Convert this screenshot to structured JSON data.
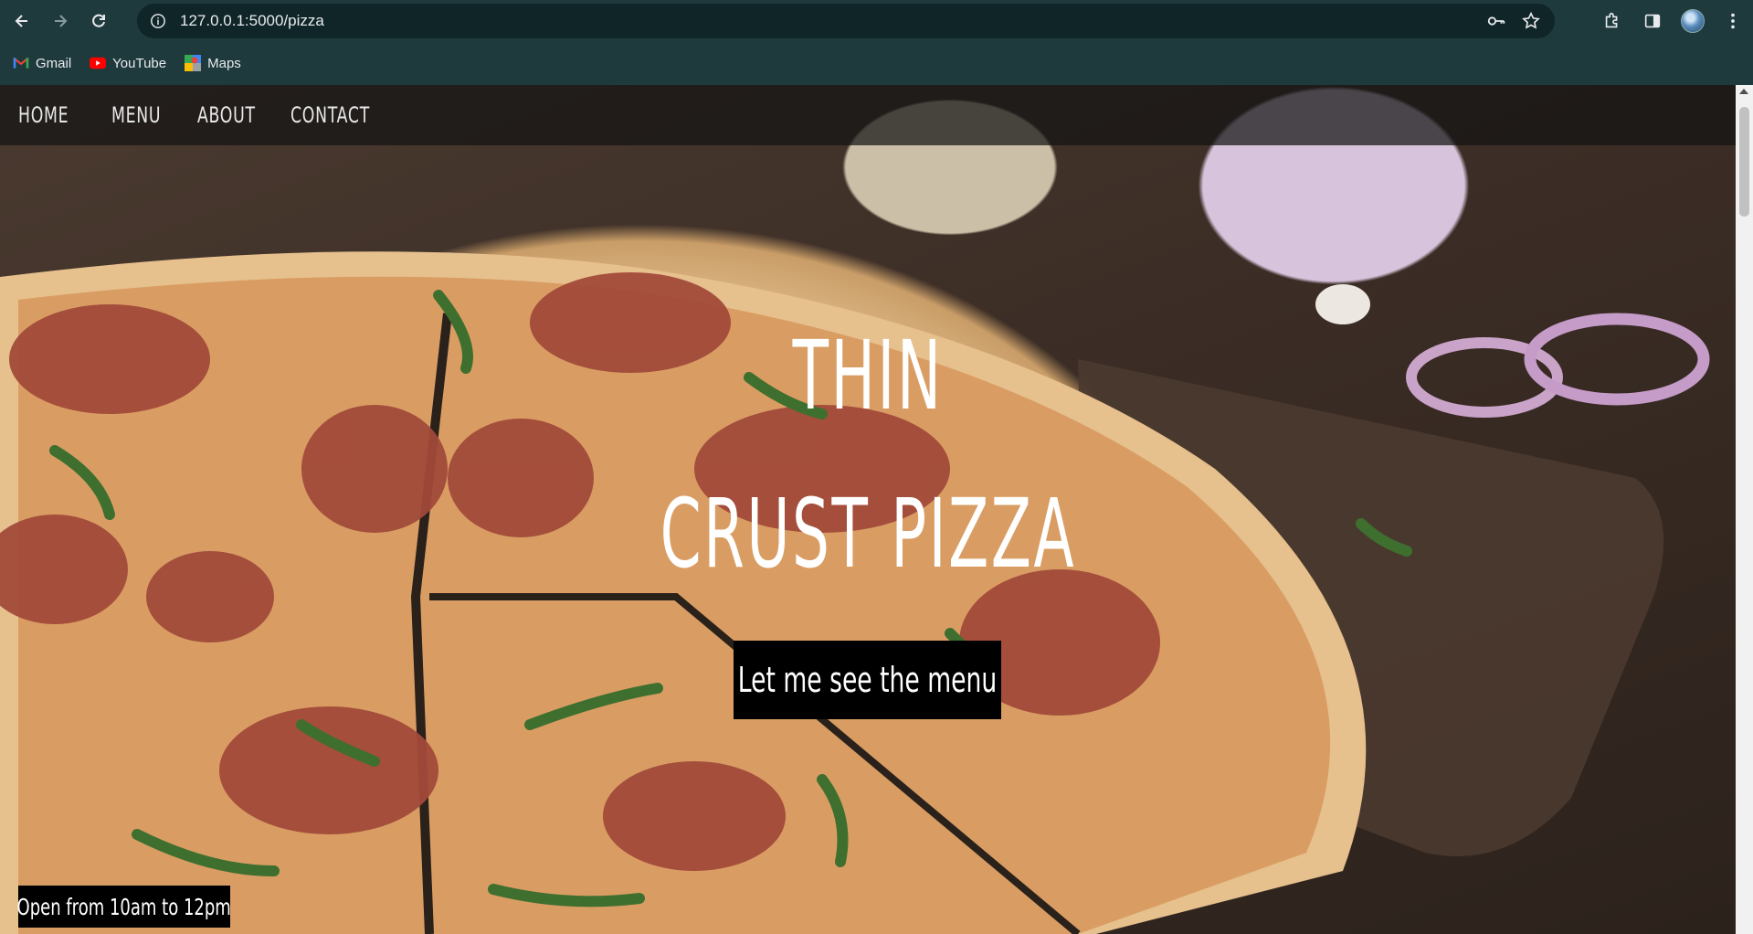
{
  "browser": {
    "url": "127.0.0.1:5000/pizza",
    "bookmarks": [
      {
        "label": "Gmail",
        "icon": "gmail-icon"
      },
      {
        "label": "YouTube",
        "icon": "youtube-icon"
      },
      {
        "label": "Maps",
        "icon": "maps-icon"
      }
    ]
  },
  "page": {
    "nav": [
      "HOME",
      "MENU",
      "ABOUT",
      "CONTACT"
    ],
    "hero": {
      "line1": "THIN",
      "line2": "CRUST PIZZA",
      "button": "Let me see the menu"
    },
    "hours": "Open from 10am to 12pm",
    "background_image": "pepperoni pizza with basil on wooden board"
  },
  "colors": {
    "chrome": "#1f3a3d",
    "omnibox": "#0f2527",
    "button_bg": "#000000",
    "text": "#ffffff"
  }
}
